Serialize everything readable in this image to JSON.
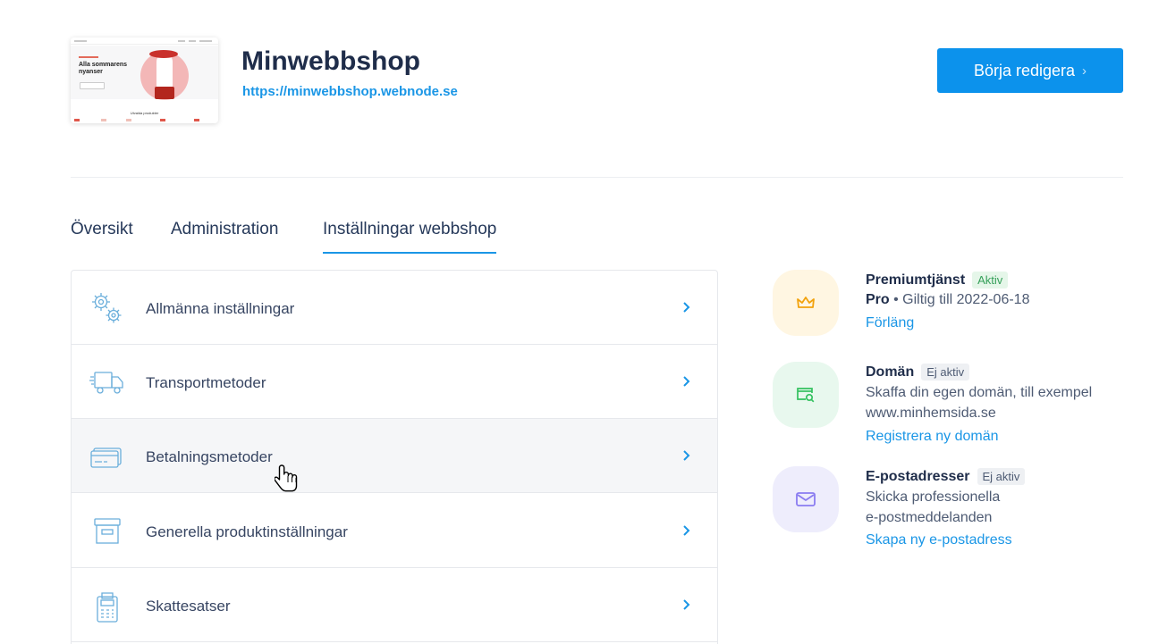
{
  "header": {
    "site_name": "Minwebbshop",
    "site_url": "https://minwebbshop.webnode.se",
    "edit_button": "Börja redigera",
    "thumbnail": {
      "headline": "Alla sommarens nyanser",
      "section": "Utvalda produkter"
    }
  },
  "tabs": [
    {
      "label": "Översikt",
      "active": false
    },
    {
      "label": "Administration",
      "active": false
    },
    {
      "label": "Inställningar webbshop",
      "active": true
    }
  ],
  "settings": [
    {
      "label": "Allmänna inställningar",
      "icon": "gears-icon"
    },
    {
      "label": "Transportmetoder",
      "icon": "truck-icon"
    },
    {
      "label": "Betalningsmetoder",
      "icon": "credit-card-icon"
    },
    {
      "label": "Generella produktinställningar",
      "icon": "box-icon"
    },
    {
      "label": "Skattesatser",
      "icon": "calculator-icon"
    }
  ],
  "services": {
    "premium": {
      "title": "Premiumtjänst",
      "badge": "Aktiv",
      "plan": "Pro",
      "validity": " • Giltig till 2022-06-18",
      "link": "Förläng"
    },
    "domain": {
      "title": "Domän",
      "badge": "Ej aktiv",
      "line1": "Skaffa din egen domän, till exempel",
      "line2": "www.minhemsida.se",
      "link": "Registrera ny domän"
    },
    "email": {
      "title": "E-postadresser",
      "badge": "Ej aktiv",
      "line1": "Skicka professionella",
      "line2": "e-postmeddelanden",
      "link": "Skapa ny e-postadress"
    }
  },
  "colors": {
    "accent": "#0c92ec",
    "premium_bg": "#fff6e2",
    "domain_bg": "#e8f8ee",
    "email_bg": "#eeedfc"
  }
}
